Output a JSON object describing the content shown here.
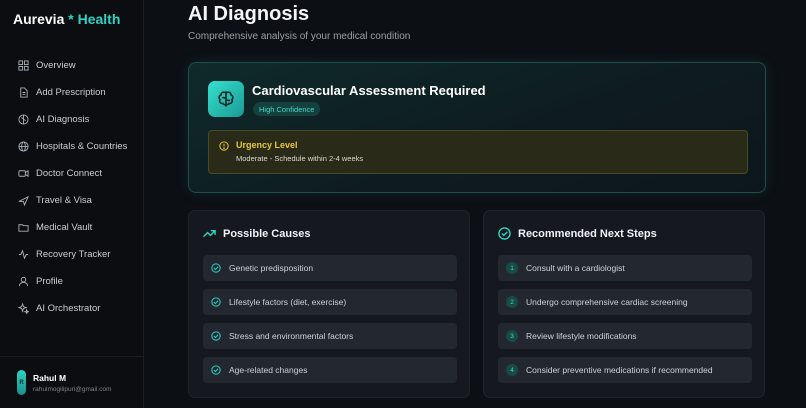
{
  "brand": {
    "name_part1": "Aurevia",
    "name_part2": "* Health"
  },
  "sidebar": {
    "items": [
      {
        "label": "Overview",
        "icon": "grid-icon"
      },
      {
        "label": "Add Prescription",
        "icon": "document-icon"
      },
      {
        "label": "AI Diagnosis",
        "icon": "brain-icon"
      },
      {
        "label": "Hospitals & Countries",
        "icon": "globe-icon"
      },
      {
        "label": "Doctor Connect",
        "icon": "video-icon"
      },
      {
        "label": "Travel & Visa",
        "icon": "plane-icon"
      },
      {
        "label": "Medical Vault",
        "icon": "folder-icon"
      },
      {
        "label": "Recovery Tracker",
        "icon": "activity-icon"
      },
      {
        "label": "Profile",
        "icon": "user-icon"
      },
      {
        "label": "AI Orchestrator",
        "icon": "sparkles-icon"
      }
    ]
  },
  "user": {
    "initial": "R",
    "name": "Rahul M",
    "email": "rahulmogilipuri@gmail.com"
  },
  "page": {
    "title": "AI Diagnosis",
    "subtitle": "Comprehensive analysis of your medical condition"
  },
  "diagnosis": {
    "title": "Cardiovascular Assessment Required",
    "confidence": "High Confidence",
    "urgency_title": "Urgency Level",
    "urgency_text": "Moderate - Schedule within 2-4 weeks"
  },
  "causes": {
    "title": "Possible Causes",
    "items": [
      "Genetic predisposition",
      "Lifestyle factors (diet, exercise)",
      "Stress and environmental factors",
      "Age-related changes"
    ]
  },
  "steps": {
    "title": "Recommended Next Steps",
    "items": [
      {
        "num": "1",
        "text": "Consult with a cardiologist"
      },
      {
        "num": "2",
        "text": "Undergo comprehensive cardiac screening"
      },
      {
        "num": "3",
        "text": "Review lifestyle modifications"
      },
      {
        "num": "4",
        "text": "Consider preventive medications if recommended"
      }
    ]
  },
  "colors": {
    "accent": "#2fd3c4",
    "warning": "#e5c93a",
    "background": "#0c0f13"
  }
}
